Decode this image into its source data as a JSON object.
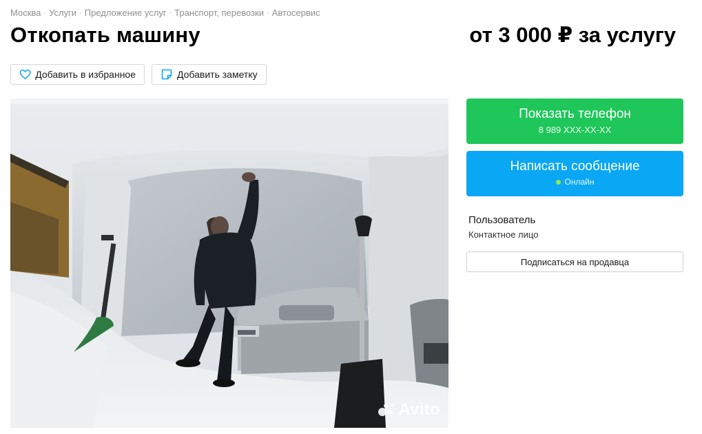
{
  "breadcrumbs": [
    "Москва",
    "Услуги",
    "Предложение услуг",
    "Транспорт, перевозки",
    "Автосервис"
  ],
  "breadcrumb_separator": "·",
  "listing": {
    "title": "Откопать машину",
    "price": "от 3 000 ₽ за услугу"
  },
  "actions": {
    "favorite_label": "Добавить в избранное",
    "note_label": "Добавить заметку"
  },
  "photo": {
    "watermark": "Avito",
    "description_icon": "photo-of-man-digging-car-out-of-snow"
  },
  "contact": {
    "phone_button_label": "Показать телефон",
    "phone_masked": "8 989 XXX-XX-XX",
    "message_button_label": "Написать сообщение",
    "online_status": "Онлайн"
  },
  "seller": {
    "name": "Пользователь",
    "role": "Контактное лицо",
    "subscribe_label": "Подписаться на продавца"
  },
  "colors": {
    "phone_button": "#1fc65a",
    "message_button": "#0aa7f5",
    "online_dot": "#9be64a",
    "breadcrumb_text": "#8f8f8f"
  }
}
